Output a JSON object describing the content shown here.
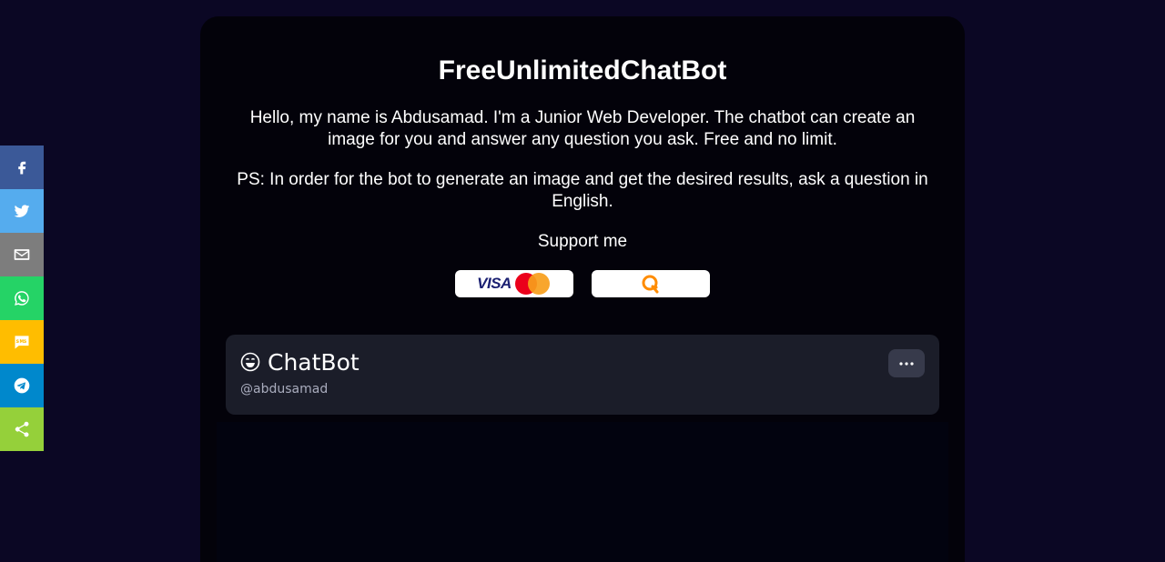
{
  "share": {
    "items": [
      {
        "name": "facebook",
        "icon": "facebook-icon",
        "color": "#3b5998"
      },
      {
        "name": "twitter",
        "icon": "twitter-icon",
        "color": "#55acee"
      },
      {
        "name": "email",
        "icon": "email-icon",
        "color": "#7d7d7d"
      },
      {
        "name": "whatsapp",
        "icon": "whatsapp-icon",
        "color": "#25d366"
      },
      {
        "name": "sms",
        "icon": "sms-icon",
        "color": "#ffbd00"
      },
      {
        "name": "telegram",
        "icon": "telegram-icon",
        "color": "#0088cc"
      },
      {
        "name": "share",
        "icon": "share-icon",
        "color": "#95d03a"
      }
    ]
  },
  "main": {
    "title": "FreeUnlimitedChatBot",
    "intro": "Hello, my name is Abdusamad. I'm a Junior Web Developer. The chatbot can create an image for you and answer any question you ask. Free and no limit.",
    "ps": "PS: In order for the bot to generate an image and get the desired results, ask a question in English.",
    "support": "Support me",
    "payments": {
      "visa_label": "VISA",
      "card_icon": "visa-mastercard-icon",
      "qiwi_icon": "qiwi-icon"
    }
  },
  "chat": {
    "name": "ChatBot",
    "emoji_icon": "smiling-face-icon",
    "handle": "@abdusamad",
    "menu_icon": "more-dots-icon"
  },
  "colors": {
    "page_bg": "#0b0724",
    "panel_bg": "#03020a",
    "chat_header_bg": "#1b1d29"
  }
}
